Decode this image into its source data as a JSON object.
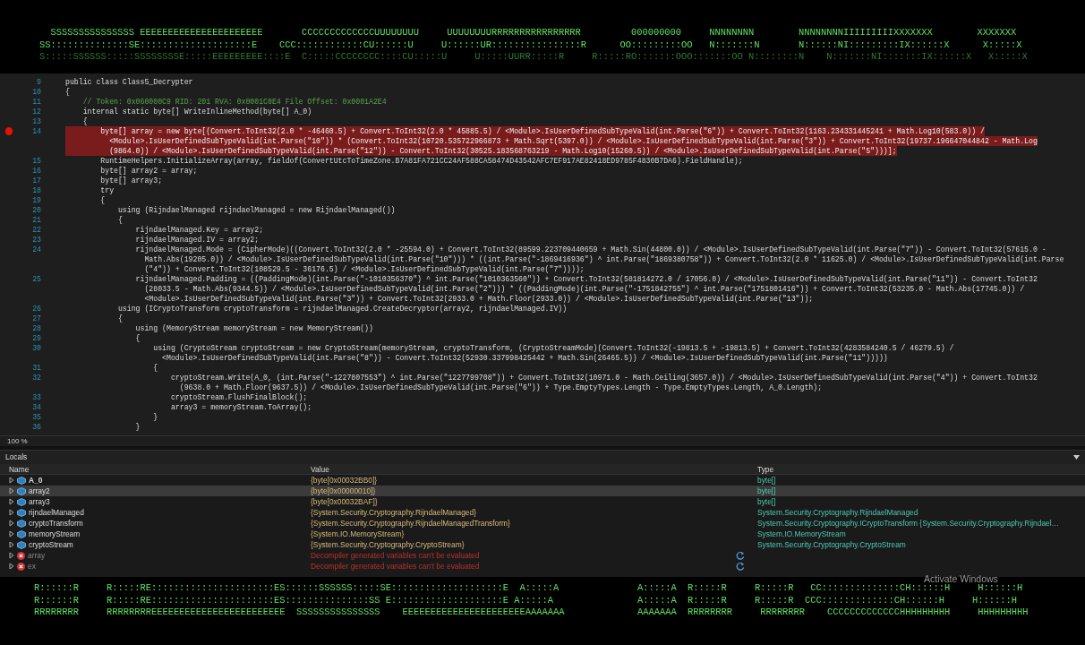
{
  "banner_top": {
    "rows": [
      "  SSSSSSSSSSSSSSS EEEEEEEEEEEEEEEEEEEEEE       CCCCCCCCCCCCCUUUUUUUU     UUUUUUUURRRRRRRRRRRRRRRR         000000000     NNNNNNNN        NNNNNNNNIIIIIIIIIXXXXXXX        XXXXXXX",
      "SS::::::::::::::SE::::::::::::::::::::E    CCC::::::::::::CU::::::U     U::::::UR::::::::::::::::R      OO:::::::::OO   N:::::::N       N::::::NI:::::::::IX::::::X      X:::::X",
      "S:::::SSSSSS:::::SSSSSSSSE:::::EEEEEEEEE::::E  C:::::CCCCCCCC::::CU:::::U     U:::::UURR:::::R     R:::::RO:::::::OOO:::::::OO N::::::::N    N:::::::NI:::::::IX::::::X   X:::::X"
    ]
  },
  "code": {
    "lines": [
      {
        "number": "9",
        "kind": "code",
        "breakpoint": false,
        "rows": [
          "public class Class5_Decrypter"
        ]
      },
      {
        "number": "10",
        "kind": "code",
        "breakpoint": false,
        "rows": [
          "{"
        ]
      },
      {
        "number": "11",
        "kind": "comment",
        "breakpoint": false,
        "rows": [
          "    // Token: 0x060000C9 RID: 201 RVA: 0x0001C0E4 File Offset: 0x0001A2E4"
        ]
      },
      {
        "number": "12",
        "kind": "code",
        "breakpoint": false,
        "rows": [
          "    internal static byte[] WriteInlineMethod(byte[] A_0)"
        ]
      },
      {
        "number": "13",
        "kind": "code",
        "breakpoint": false,
        "rows": [
          "    {"
        ]
      },
      {
        "number": "14",
        "kind": "code",
        "breakpoint": true,
        "rows": [
          "        byte[] array = new byte[(Convert.ToInt32(2.0 * -46460.5) + Convert.ToInt32(2.0 * 45885.5) / <Module>.IsUserDefinedSubTypeValid(int.Parse(\"6\")) + Convert.ToInt32(1163.234331445241 + Math.Log10(583.0)) /",
          "          <Module>.IsUserDefinedSubTypeValid(int.Parse(\"10\")) * (Convert.ToInt32(10720.535722966873 + Math.Sqrt(5397.0)) / <Module>.IsUserDefinedSubTypeValid(int.Parse(\"3\")) + Convert.ToInt32(19737.196647044842 - Math.Log",
          "          (9864.0)) / <Module>.IsUserDefinedSubTypeValid(int.Parse(\"12\")) - Convert.ToInt32(30525.183568763219 - Math.Log10(15260.5)) / <Module>.IsUserDefinedSubTypeValid(int.Parse(\"5\")))];"
        ]
      },
      {
        "number": "15",
        "kind": "code",
        "breakpoint": false,
        "rows": [
          "        RuntimeHelpers.InitializeArray(array, fieldof(ConvertUtcToTimeZone.B7A81FA721CC24AF588CA58474D43542AFC7EF917AE82418ED9785F4830B7DA6).FieldHandle);"
        ]
      },
      {
        "number": "16",
        "kind": "code",
        "breakpoint": false,
        "rows": [
          "        byte[] array2 = array;"
        ]
      },
      {
        "number": "17",
        "kind": "code",
        "breakpoint": false,
        "rows": [
          "        byte[] array3;"
        ]
      },
      {
        "number": "18",
        "kind": "code",
        "breakpoint": false,
        "rows": [
          "        try"
        ]
      },
      {
        "number": "19",
        "kind": "code",
        "breakpoint": false,
        "rows": [
          "        {"
        ]
      },
      {
        "number": "20",
        "kind": "code",
        "breakpoint": false,
        "rows": [
          "            using (RijndaelManaged rijndaelManaged = new RijndaelManaged())"
        ]
      },
      {
        "number": "21",
        "kind": "code",
        "breakpoint": false,
        "rows": [
          "            {"
        ]
      },
      {
        "number": "22",
        "kind": "code",
        "breakpoint": false,
        "rows": [
          "                rijndaelManaged.Key = array2;"
        ]
      },
      {
        "number": "23",
        "kind": "code",
        "breakpoint": false,
        "rows": [
          "                rijndaelManaged.IV = array2;"
        ]
      },
      {
        "number": "24",
        "kind": "code",
        "breakpoint": false,
        "rows": [
          "                rijndaelManaged.Mode = (CipherMode)((Convert.ToInt32(2.0 * -25594.0) + Convert.ToInt32(89599.223709440659 + Math.Sin(44800.0)) / <Module>.IsUserDefinedSubTypeValid(int.Parse(\"7\")) - Convert.ToInt32(57615.0 -",
          "                  Math.Abs(19205.0)) / <Module>.IsUserDefinedSubTypeValid(int.Parse(\"10\"))) * ((int.Parse(\"-1869416936\") ^ int.Parse(\"1869380758\")) + Convert.ToInt32(2.0 * 11625.0) / <Module>.IsUserDefinedSubTypeValid(int.Parse",
          "                  (\"4\")) + Convert.ToInt32(108529.5 - 36176.5) / <Module>.IsUserDefinedSubTypeValid(int.Parse(\"7\"))));"
        ]
      },
      {
        "number": "25",
        "kind": "code",
        "breakpoint": false,
        "rows": [
          "                rijndaelManaged.Padding = ((PaddingMode)(int.Parse(\"-1010356370\") ^ int.Parse(\"1010363560\")) + Convert.ToInt32(581814272.0 / 17056.0) / <Module>.IsUserDefinedSubTypeValid(int.Parse(\"11\")) - Convert.ToInt32",
          "                  (28033.5 - Math.Abs(9344.5)) / <Module>.IsUserDefinedSubTypeValid(int.Parse(\"2\"))) * ((PaddingMode)(int.Parse(\"-1751842755\") ^ int.Parse(\"1751801416\")) + Convert.ToInt32(53235.0 - Math.Abs(17745.0)) /",
          "                  <Module>.IsUserDefinedSubTypeValid(int.Parse(\"3\")) + Convert.ToInt32(2933.0 + Math.Floor(2933.0)) / <Module>.IsUserDefinedSubTypeValid(int.Parse(\"13\"));"
        ]
      },
      {
        "number": "26",
        "kind": "code",
        "breakpoint": false,
        "rows": [
          "            using (ICryptoTransform cryptoTransform = rijndaelManaged.CreateDecryptor(array2, rijndaelManaged.IV))"
        ]
      },
      {
        "number": "27",
        "kind": "code",
        "breakpoint": false,
        "rows": [
          "            {"
        ]
      },
      {
        "number": "28",
        "kind": "code",
        "breakpoint": false,
        "rows": [
          "                using (MemoryStream memoryStream = new MemoryStream())"
        ]
      },
      {
        "number": "29",
        "kind": "code",
        "breakpoint": false,
        "rows": [
          "                {"
        ]
      },
      {
        "number": "30",
        "kind": "code",
        "breakpoint": false,
        "rows": [
          "                    using (CryptoStream cryptoStream = new CryptoStream(memoryStream, cryptoTransform, (CryptoStreamMode)(Convert.ToInt32(-19813.5 + -19813.5) + Convert.ToInt32(4283584240.5 / 46279.5) /",
          "                      <Module>.IsUserDefinedSubTypeValid(int.Parse(\"8\")) - Convert.ToInt32(52930.337998425442 + Math.Sin(26465.5)) / <Module>.IsUserDefinedSubTypeValid(int.Parse(\"11\")))))"
        ]
      },
      {
        "number": "31",
        "kind": "code",
        "breakpoint": false,
        "rows": [
          "                    {"
        ]
      },
      {
        "number": "32",
        "kind": "code",
        "breakpoint": false,
        "rows": [
          "                        cryptoStream.Write(A_0, (int.Parse(\"-1227807553\") ^ int.Parse(\"1227799708\")) + Convert.ToInt32(10971.0 - Math.Ceiling(3657.0)) / <Module>.IsUserDefinedSubTypeValid(int.Parse(\"4\")) + Convert.ToInt32",
          "                          (9638.0 + Math.Floor(9637.5)) / <Module>.IsUserDefinedSubTypeValid(int.Parse(\"6\")) + Type.EmptyTypes.Length - Type.EmptyTypes.Length, A_0.Length);"
        ]
      },
      {
        "number": "33",
        "kind": "code",
        "breakpoint": false,
        "rows": [
          "                        cryptoStream.FlushFinalBlock();"
        ]
      },
      {
        "number": "34",
        "kind": "code",
        "breakpoint": false,
        "rows": [
          "                        array3 = memoryStream.ToArray();"
        ]
      },
      {
        "number": "35",
        "kind": "code",
        "breakpoint": false,
        "rows": [
          "                    }"
        ]
      },
      {
        "number": "36",
        "kind": "code",
        "breakpoint": false,
        "rows": [
          "                }"
        ]
      }
    ],
    "zoom": "100 %"
  },
  "locals": {
    "title": "Locals",
    "columns": [
      "Name",
      "Value",
      "Type"
    ],
    "rows": [
      {
        "kind": "variable",
        "name": "A_0",
        "value": "{byte[0x00032BB0]}",
        "type": "byte[]",
        "selected": false,
        "emphasized": true
      },
      {
        "kind": "variable",
        "name": "array2",
        "value": "{byte[0x00000010]}",
        "type": "byte[]",
        "selected": true,
        "emphasized": false
      },
      {
        "kind": "variable",
        "name": "array3",
        "value": "{byte[0x00032BAF]}",
        "type": "byte[]",
        "selected": false,
        "emphasized": false
      },
      {
        "kind": "variable",
        "name": "rijndaelManaged",
        "value": "{System.Security.Cryptography.RijndaelManaged}",
        "type": "System.Security.Cryptography.RijndaelManaged",
        "selected": false,
        "emphasized": false
      },
      {
        "kind": "variable",
        "name": "cryptoTransform",
        "value": "{System.Security.Cryptography.RijndaelManagedTransform}",
        "type": "System.Security.Cryptography.ICryptoTransform {System.Security.Cryptography.Rijndael…",
        "selected": false,
        "emphasized": false
      },
      {
        "kind": "variable",
        "name": "memoryStream",
        "value": "{System.IO.MemoryStream}",
        "type": "System.IO.MemoryStream",
        "selected": false,
        "emphasized": false
      },
      {
        "kind": "variable",
        "name": "cryptoStream",
        "value": "{System.Security.Cryptography.CryptoStream}",
        "type": "System.Security.Cryptography.CryptoStream",
        "selected": false,
        "emphasized": false
      },
      {
        "kind": "error",
        "name": "array",
        "value": "Decompiler generated variables can't be evaluated",
        "selected": false,
        "emphasized": false
      },
      {
        "kind": "error",
        "name": "ex",
        "value": "Decompiler generated variables can't be evaluated",
        "selected": false,
        "emphasized": false
      }
    ]
  },
  "activation_notice": "Activate Windows",
  "banner_bottom": {
    "rows": [
      {
        "left": "R::::::R     R:::::RE::::::::::::::::::::::ES::::::SSSSSS:::::SE::::::::::::::::::::E  A:::::A",
        "right": "A:::::A  R:::::R     R:::::R   CC::::::::::::::CH::::::H     H::::::H"
      },
      {
        "left": "R::::::R     R:::::RE::::::::::::::::::::::ES:::::::::::::::SS E::::::::::::::::::::E A:::::A",
        "right": "A:::::A  R:::::R     R:::::R  CCC:::::::::::::CH::::::H     H::::::H"
      },
      {
        "left": "RRRRRRRR     RRRRRRRREEEEEEEEEEEEEEEEEEEEEEEE  SSSSSSSSSSSSSSS    EEEEEEEEEEEEEEEEEEEEEEAAAAAAA",
        "right": "AAAAAAA  RRRRRRRR     RRRRRRRR    CCCCCCCCCCCCCHHHHHHHHH     HHHHHHHHH"
      }
    ]
  }
}
